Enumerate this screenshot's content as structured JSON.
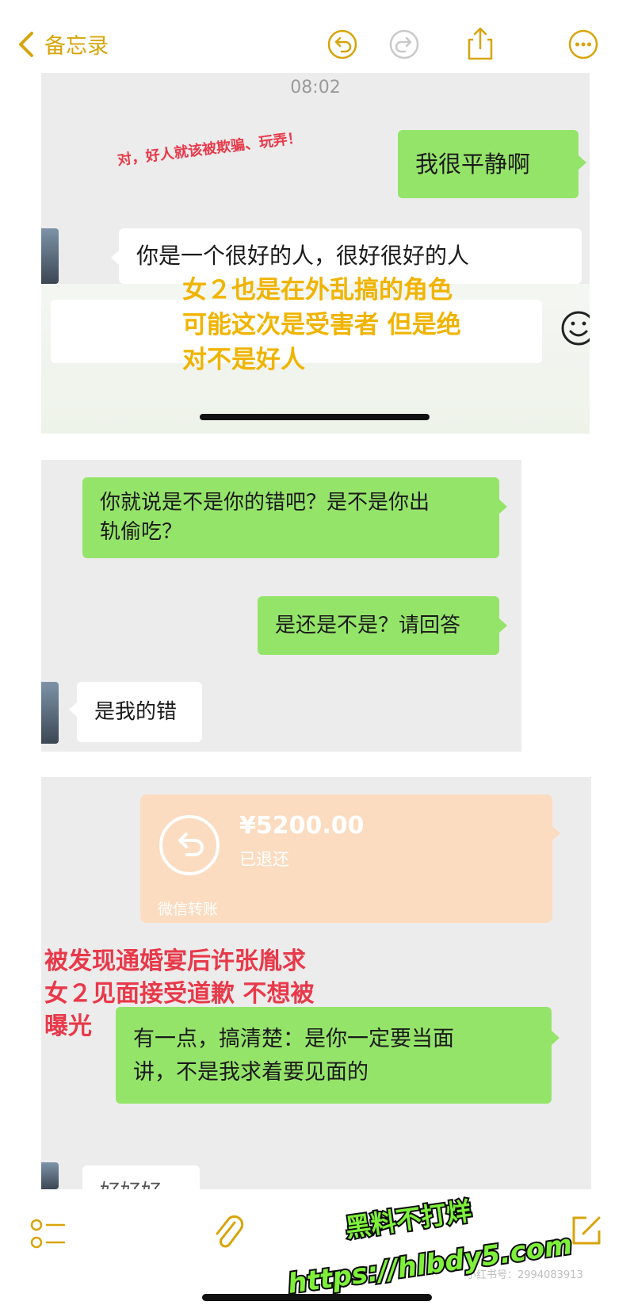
{
  "nav": {
    "back_label": "备忘录",
    "accent_color": "#d8a40a",
    "icons": [
      "undo-icon",
      "redo-icon",
      "share-icon",
      "more-icon"
    ]
  },
  "chat1": {
    "timestamp": "08:02",
    "annotation_red": "对，好人就该被欺骗、玩弄！",
    "msg_sent": "我很平静啊",
    "msg_recv": "你是一个很好的人，很好很好的人",
    "annotation_yellow_lines": [
      "女２也是在外乱搞的角色",
      "可能这次是受害者 但是绝",
      "对不是好人"
    ]
  },
  "chat2": {
    "msg_sent_1_lines": [
      "你就说是不是你的错吧？是不是你出",
      "轨偷吃？"
    ],
    "msg_sent_2": "是还是不是？请回答",
    "msg_recv": "是我的错"
  },
  "chat3": {
    "transfer_amount": "¥5200.00",
    "transfer_status": "已退还",
    "transfer_footer": "微信转账",
    "annotation_red_lines": [
      "被发现通婚宴后许张胤求",
      "女２见面接受道歉 不想被",
      "曝光"
    ],
    "msg_sent_lines": [
      "有一点，搞清楚：是你一定要当面",
      "讲，不是我求着要见面的"
    ],
    "msg_recv_partial": "好好好"
  },
  "watermark": {
    "line1": "黑料不打烊",
    "line2": "https://hlbdy5.com",
    "small_id": "小红书号：2994083913"
  },
  "colors": {
    "green_bubble": "#95e46a",
    "panel_bg": "#ececec",
    "annotation_red": "#e8394a",
    "annotation_yellow": "#f0b400",
    "transfer_bg": "#fbdcc0",
    "watermark_green": "#7ef03a"
  }
}
